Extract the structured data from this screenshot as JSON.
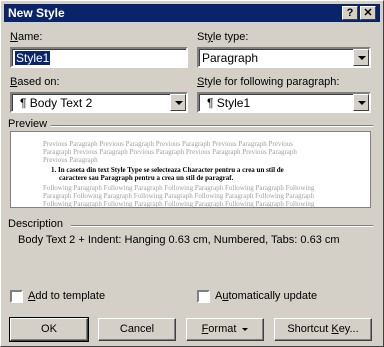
{
  "window": {
    "title": "New Style",
    "help_glyph": "?",
    "close_glyph": "✕"
  },
  "name": {
    "label_ul": "N",
    "label_rest": "ame:",
    "value": "Style1"
  },
  "style_type": {
    "label_pre": "St",
    "label_ul": "y",
    "label_rest": "le type:",
    "value": "Paragraph"
  },
  "based_on": {
    "label_ul": "B",
    "label_rest": "ased on:",
    "value": "¶ Body Text 2"
  },
  "following": {
    "label_ul": "S",
    "label_rest": "tyle for following paragraph:",
    "value": "¶ Style1"
  },
  "preview": {
    "heading": "Preview",
    "prev_lines": [
      "Previous Paragraph Previous Paragraph Previous Paragraph Previous Paragraph Previous",
      "Paragraph Previous Paragraph Previous Paragraph Previous Paragraph Previous Paragraph",
      "Previous Paragraph"
    ],
    "sample_lines": [
      "1.  In caseta din text Style Type se selecteaza Character pentru a crea un stil de",
      "caractere sau Paragraph pentru a crea un stil de paragraf."
    ],
    "follow_lines": [
      "Following Paragraph Following Paragraph Following Paragraph Following Paragraph Following",
      "Paragraph Following Paragraph Following Paragraph Following Paragraph Following Paragraph",
      "Following Paragraph Following Paragraph Following Paragraph Following Paragraph Following"
    ]
  },
  "description": {
    "heading": "Description",
    "text": "Body Text 2 + Indent: Hanging  0.63 cm, Numbered, Tabs: 0.63 cm"
  },
  "add_to_template": {
    "label_ul": "A",
    "label_rest": "dd to template",
    "checked": false
  },
  "auto_update": {
    "label_pre": "A",
    "label_ul": "u",
    "label_rest": "tomatically update",
    "checked": false
  },
  "buttons": {
    "ok": "OK",
    "cancel": "Cancel",
    "format_ul": "F",
    "format_rest": "ormat",
    "shortcut_pre": "Shortcut ",
    "shortcut_ul": "K",
    "shortcut_rest": "ey..."
  }
}
